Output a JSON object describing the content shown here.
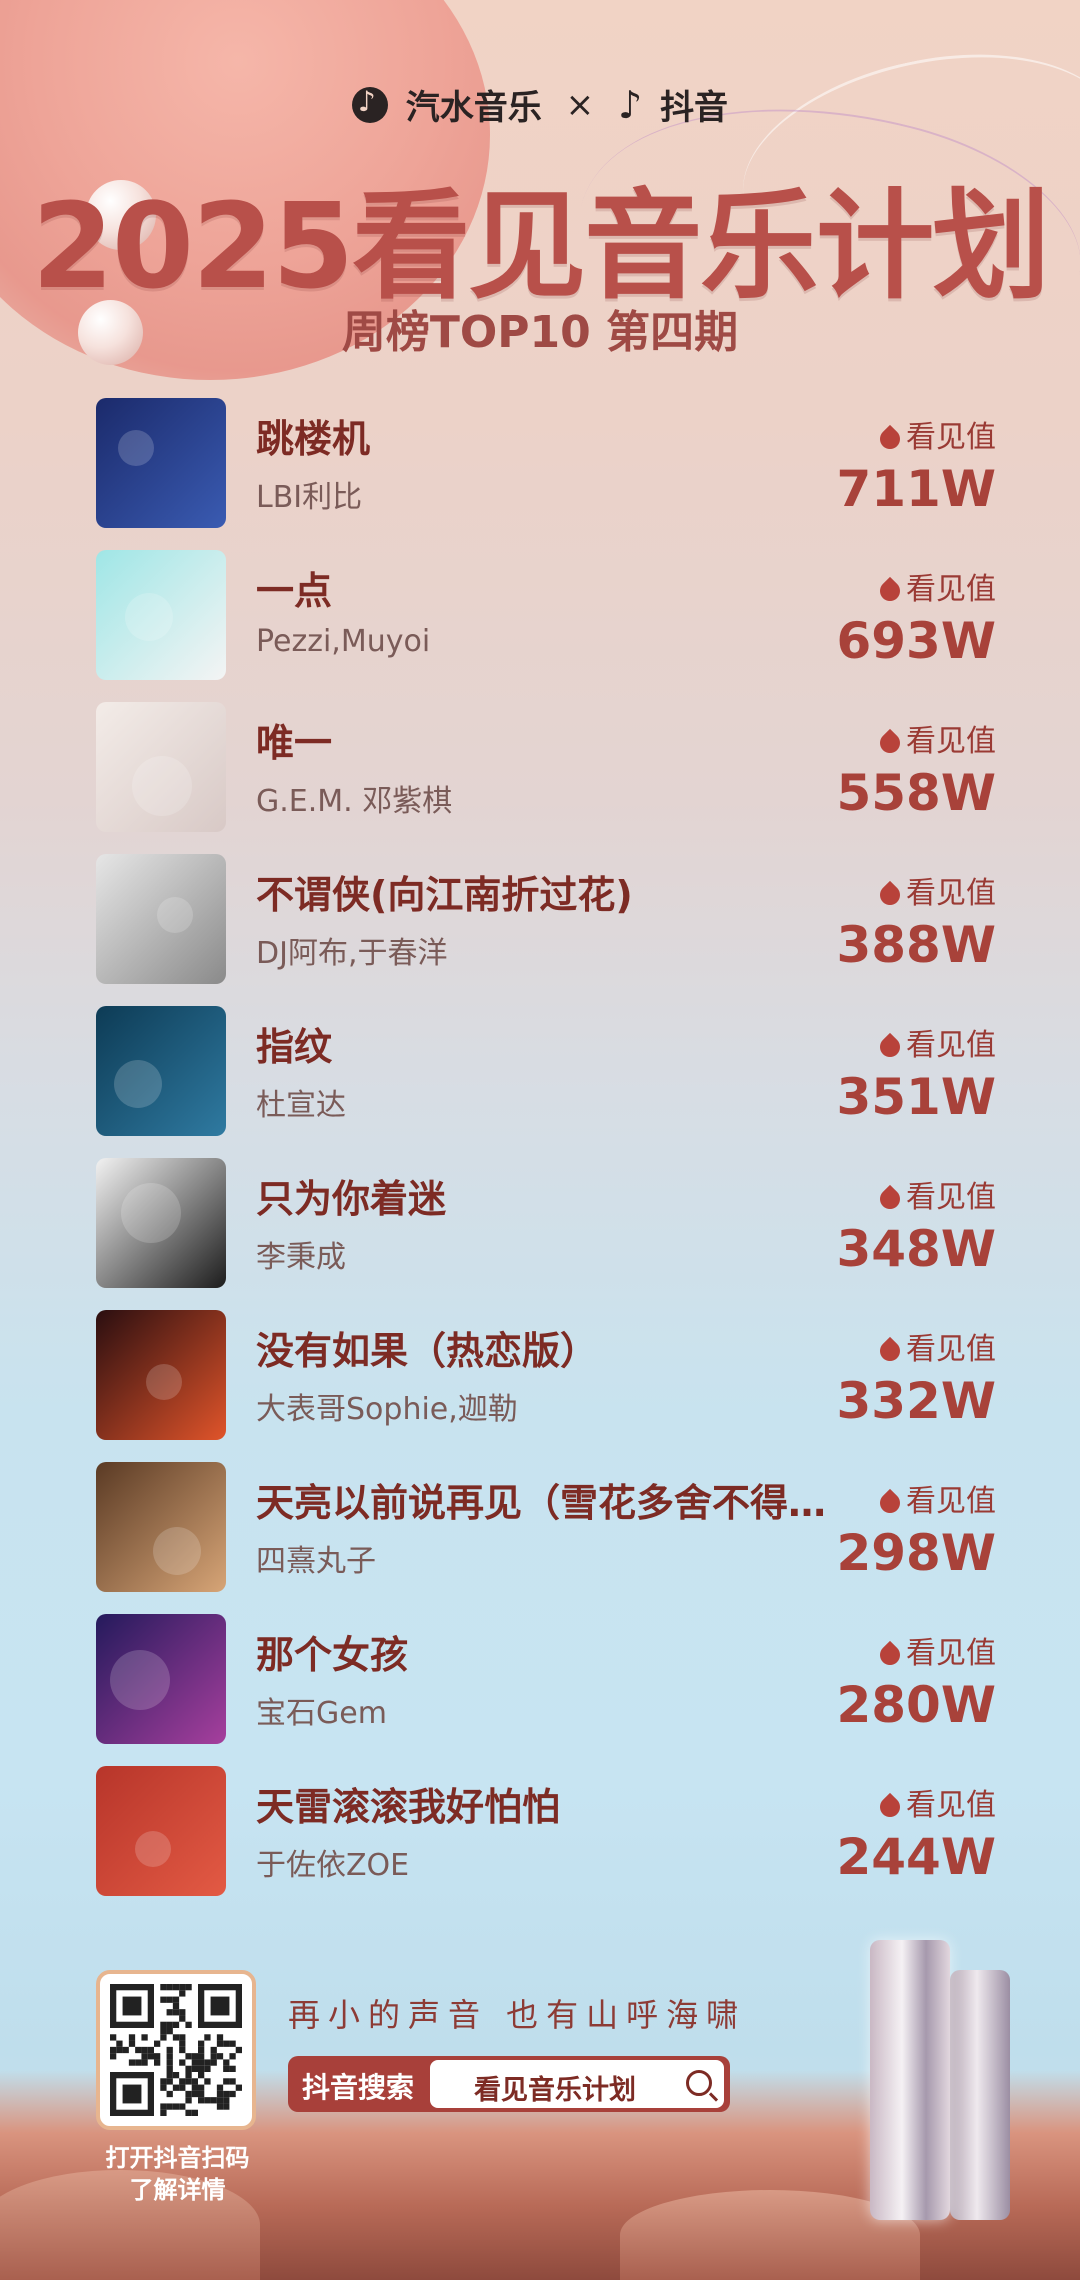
{
  "header": {
    "brand_left": "汽水音乐",
    "separator": "×",
    "brand_right": "抖音",
    "title": "2025看见音乐计划",
    "subtitle": "周榜TOP10 第四期"
  },
  "metric_label": "看见值",
  "chart": [
    {
      "song": "跳楼机",
      "artist": "LBI利比",
      "value": "711W"
    },
    {
      "song": "一点",
      "artist": "Pezzi,Muyoi",
      "value": "693W"
    },
    {
      "song": "唯一",
      "artist": "G.E.M. 邓紫棋",
      "value": "558W"
    },
    {
      "song": "不谓侠(向江南折过花)",
      "artist": "DJ阿布,于春洋",
      "value": "388W"
    },
    {
      "song": "指纹",
      "artist": "杜宣达",
      "value": "351W"
    },
    {
      "song": "只为你着迷",
      "artist": "李秉成",
      "value": "348W"
    },
    {
      "song": "没有如果（热恋版）",
      "artist": "大表哥Sophie,迦勒",
      "value": "332W"
    },
    {
      "song": "天亮以前说再见（雪花多舍不得…",
      "artist": "四熹丸子",
      "value": "298W"
    },
    {
      "song": "那个女孩",
      "artist": "宝石Gem",
      "value": "280W"
    },
    {
      "song": "天雷滚滚我好怕怕",
      "artist": "于佐依ZOE",
      "value": "244W"
    }
  ],
  "cover_colors": [
    [
      "#1b2a6b",
      "#3a5bb2"
    ],
    [
      "#9fe6e6",
      "#f4f4f4"
    ],
    [
      "#f3ece8",
      "#d8c9c6"
    ],
    [
      "#e6e6e6",
      "#8a8a8a"
    ],
    [
      "#0d3b55",
      "#2f7aa1"
    ],
    [
      "#f2f2f2",
      "#1c1c1c"
    ],
    [
      "#2a0e10",
      "#e0542a"
    ],
    [
      "#5a3a24",
      "#d7a577"
    ],
    [
      "#241a5c",
      "#a63f9d"
    ],
    [
      "#b7352a",
      "#e35a44"
    ]
  ],
  "footer": {
    "slogan": "再小的声音 也有山呼海啸",
    "search_label": "抖音搜索",
    "search_query": "看见音乐计划",
    "qr_caption_1": "打开抖音扫码",
    "qr_caption_2": "了解详情"
  }
}
